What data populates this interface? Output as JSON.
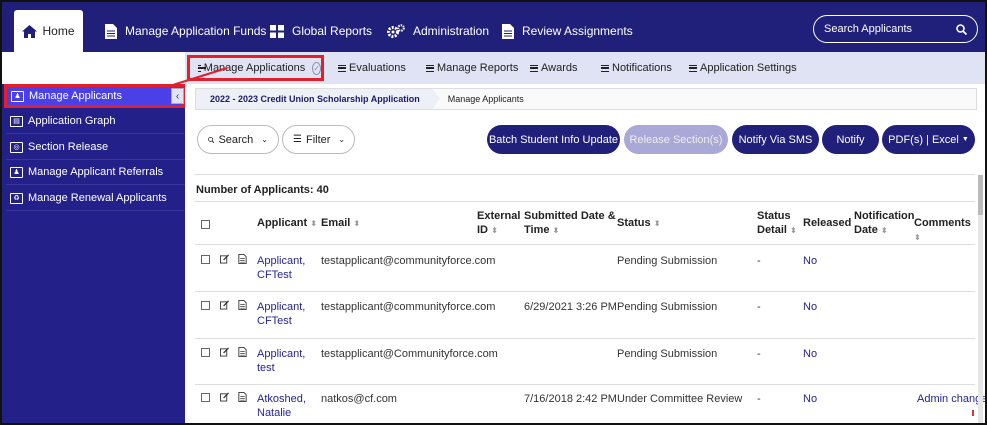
{
  "topnav": {
    "home": "Home",
    "items": [
      "Manage Application Funds",
      "Global Reports",
      "Administration",
      "Review Assignments"
    ],
    "search_placeholder": "Search Applicants"
  },
  "subnav": {
    "items": [
      "Manage Applications",
      "Evaluations",
      "Manage Reports",
      "Awards",
      "Notifications",
      "Application Settings"
    ]
  },
  "sidebar": {
    "items": [
      "Manage Applicants",
      "Application Graph",
      "Section Release",
      "Manage Applicant Referrals",
      "Manage Renewal Applicants"
    ]
  },
  "breadcrumb": [
    "2022 - 2023 Credit Union Scholarship Application",
    "Manage Applicants"
  ],
  "toolbar": {
    "search": "Search",
    "filter": "Filter",
    "batch": "Batch Student Info Update",
    "release": "Release Section(s)",
    "sms": "Notify Via SMS",
    "notify": "Notify",
    "pdf": "PDF(s) | Excel"
  },
  "count_label": "Number of Applicants: 40",
  "table": {
    "headers": {
      "applicant": "Applicant",
      "email": "Email",
      "external_1": "External",
      "external_2": "ID",
      "submitted_1": "Submitted Date &",
      "submitted_2": "Time",
      "status": "Status",
      "status_detail_1": "Status",
      "status_detail_2": "Detail",
      "released": "Released",
      "notification_1": "Notification",
      "notification_2": "Date",
      "comments": "Comments"
    },
    "rows": [
      {
        "name_1": "Applicant,",
        "name_2": "CFTest",
        "email": "testapplicant@communityforce.com",
        "submitted": "",
        "status": "Pending Submission",
        "detail": "-",
        "released": "No",
        "comments": ""
      },
      {
        "name_1": "Applicant,",
        "name_2": "CFTest",
        "email": "testapplicant@communityforce.com",
        "submitted": "6/29/2021 3:26 PM",
        "status": "Pending Submission",
        "detail": "-",
        "released": "No",
        "comments": ""
      },
      {
        "name_1": "Applicant,",
        "name_2": "test",
        "email": "testapplicant@Communityforce.com",
        "submitted": "",
        "status": "Pending Submission",
        "detail": "-",
        "released": "No",
        "comments": ""
      },
      {
        "name_1": "Atkoshed,",
        "name_2": "Natalie",
        "email": "natkos@cf.com",
        "submitted": "7/16/2018 2:42 PM",
        "status": "Under Committee Review",
        "detail": "-",
        "released": "No",
        "comments": "Admin change"
      }
    ]
  }
}
